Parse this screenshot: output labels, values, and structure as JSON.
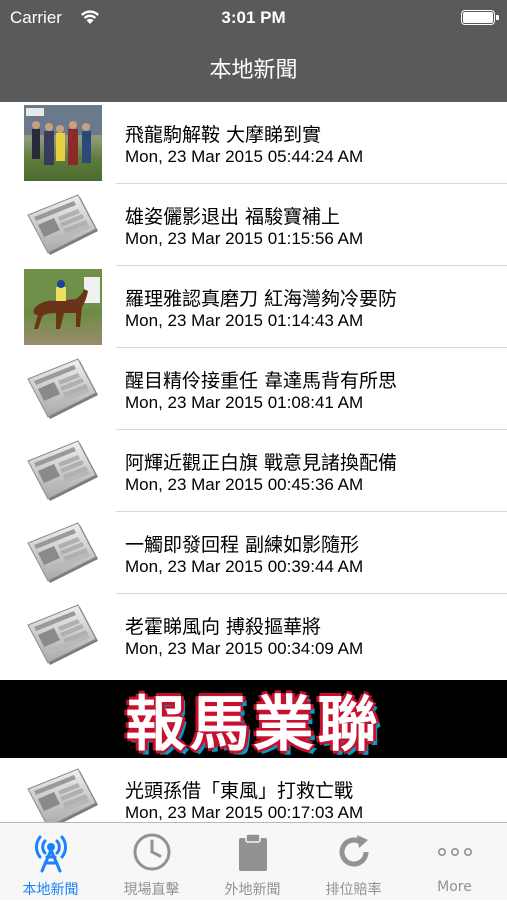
{
  "status_bar": {
    "carrier": "Carrier",
    "time": "3:01 PM"
  },
  "nav": {
    "title": "本地新聞"
  },
  "news": [
    {
      "title": "飛龍駒解鞍 大摩睇到實",
      "date": "Mon, 23 Mar 2015 05:44:24 AM",
      "thumb": "photo"
    },
    {
      "title": "雄姿儷影退出 福駿寶補上",
      "date": "Mon, 23 Mar 2015 01:15:56 AM",
      "thumb": "newspaper-icon"
    },
    {
      "title": "羅理雅認真磨刀 紅海灣夠冷要防",
      "date": "Mon, 23 Mar 2015 01:14:43 AM",
      "thumb": "photo"
    },
    {
      "title": "醒目精伶接重任 韋達馬背有所思",
      "date": "Mon, 23 Mar 2015 01:08:41 AM",
      "thumb": "newspaper-icon"
    },
    {
      "title": "阿輝近觀正白旗 戰意見諸換配備",
      "date": "Mon, 23 Mar 2015 00:45:36 AM",
      "thumb": "newspaper-icon"
    },
    {
      "title": "一觸即發回程 副練如影隨形",
      "date": "Mon, 23 Mar 2015 00:39:44 AM",
      "thumb": "newspaper-icon"
    },
    {
      "title": "老霍睇風向 搏殺摳華將",
      "date": "Mon, 23 Mar 2015 00:34:09 AM",
      "thumb": "newspaper-icon"
    },
    {
      "title": "光頭孫借「東風」打救亡戰",
      "date": "Mon, 23 Mar 2015 00:17:03 AM",
      "thumb": "newspaper-icon"
    }
  ],
  "banner": {
    "text": "報馬業聯"
  },
  "tabs": [
    {
      "label": "本地新聞",
      "icon": "antenna-icon",
      "active": true
    },
    {
      "label": "現場直擊",
      "icon": "clock-icon"
    },
    {
      "label": "外地新聞",
      "icon": "clipboard-icon"
    },
    {
      "label": "排位賠率",
      "icon": "refresh-icon"
    },
    {
      "label": "More",
      "icon": "more-icon"
    }
  ],
  "colors": {
    "nav_bg": "#5a5a5a",
    "tab_active": "#1a82fb",
    "tab_inactive": "#929292"
  }
}
